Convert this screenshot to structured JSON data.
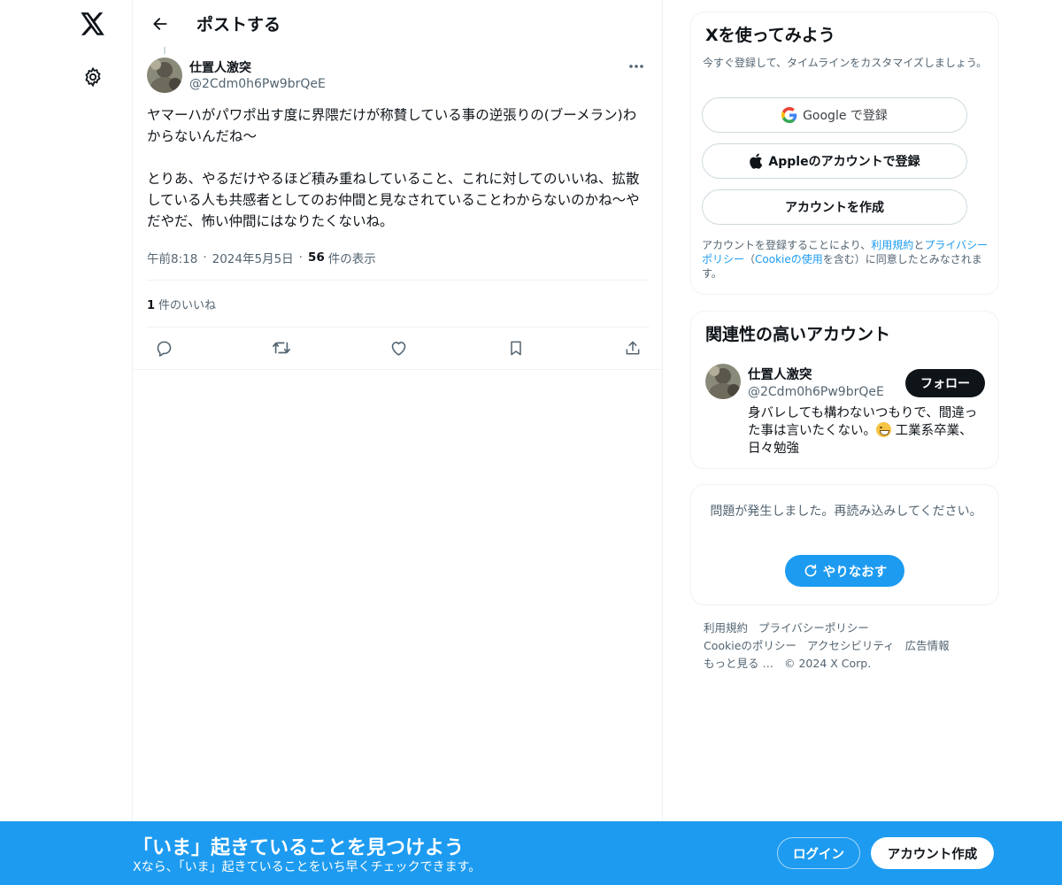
{
  "nav": {
    "logo_icon": "x-logo-icon",
    "settings_icon": "gear-icon"
  },
  "header": {
    "title": "ポストする",
    "back_icon": "arrow-left-icon"
  },
  "post": {
    "author_name": "仕置人激突",
    "author_handle": "@2Cdm0h6Pw9brQeE",
    "body": "ヤマーハがパワポ出す度に界隈だけが称賛している事の逆張りの(ブーメラン)わからないんだね〜\n\nとりあ、やるだけやるほど積み重ねしていること、これに対してのいいね、拡散している人も共感者としてのお仲間と見なされていることわからないのかね〜やだやだ、怖い仲間にはなりたくないね。",
    "time": "午前8:18",
    "date": "2024年5月5日",
    "views_count": "56",
    "views_label": "件の表示",
    "likes_count": "1",
    "likes_label": "件のいいね",
    "actions": [
      "reply-icon",
      "repost-icon",
      "like-icon",
      "bookmark-icon",
      "share-icon"
    ]
  },
  "signup": {
    "title": "Xを使ってみよう",
    "subtitle": "今すぐ登録して、タイムラインをカスタマイズしましょう。",
    "google_label": "Google で登録",
    "apple_label": "Appleのアカウントで登録",
    "create_label": "アカウントを作成",
    "terms_prefix": "アカウントを登録することにより、",
    "terms_link": "利用規約",
    "terms_and": "と",
    "privacy_link": "プライバシーポリシー",
    "terms_mid": "（",
    "cookie_link": "Cookieの使用",
    "terms_suffix": "を含む）に同意したとみなされます。"
  },
  "related": {
    "title": "関連性の高いアカウント",
    "name": "仕置人激突",
    "handle": "@2Cdm0h6Pw9brQeE",
    "follow_label": "フォロー",
    "bio_part1": "身バレしても構わないつもりで、間違った事は言いたくない。",
    "bio_part2": " 工業系卒業、日々勉強"
  },
  "error": {
    "message": "問題が発生しました。再読み込みしてください。",
    "retry_label": "やりなおす"
  },
  "footer": {
    "links": [
      "利用規約",
      "プライバシーポリシー",
      "Cookieのポリシー",
      "アクセシビリティ",
      "広告情報",
      "もっと見る …"
    ],
    "copyright": "© 2024 X Corp."
  },
  "banner": {
    "title": "「いま」起きていることを見つけよう",
    "subtitle": "Xなら、「いま」起きていることをいち早くチェックできます。",
    "login_label": "ログイン",
    "create_label": "アカウント作成"
  },
  "colors": {
    "accent": "#1d9bf0",
    "text": "#0f1419",
    "muted": "#536471",
    "border": "#eff3f4"
  }
}
